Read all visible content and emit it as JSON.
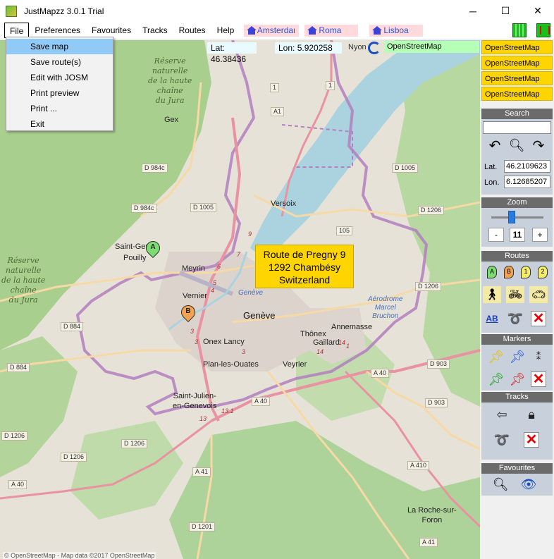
{
  "window": {
    "title": "JustMapzz 3.0.1 Trial",
    "minimize": "─",
    "maximize": "☐",
    "close": "✕"
  },
  "menu": {
    "file": "File",
    "preferences": "Preferences",
    "favourites": "Favourites",
    "tracks": "Tracks",
    "routes": "Routes",
    "help": "Help",
    "quick_favs": [
      "Amsterdam",
      "Roma",
      "Lisboa"
    ]
  },
  "file_menu": {
    "items": [
      "Save map",
      "Save route(s)",
      "Edit with JOSM",
      "Print preview",
      "Print ...",
      "Exit"
    ]
  },
  "map": {
    "lat_label": "Lat:",
    "lat_value": "46.38436",
    "lon_label": "Lon:",
    "lon_value": "5.920258",
    "source": "OpenStreetMap",
    "info_box": [
      "Route de Pregny 9",
      "1292 Chambésy",
      "Switzerland"
    ],
    "attribution": "© OpenStreetMap - Map data ©2017 OpenStreetMap",
    "labels": {
      "reserve_top": [
        "Réserve",
        "naturelle",
        "de la haute",
        "chaîne",
        "du Jura"
      ],
      "reserve_left": [
        "Réserve",
        "naturelle",
        "de la haute",
        "chaîne",
        "du Jura"
      ],
      "gex": "Gex",
      "versoix": "Versoix",
      "saint_genis": "Saint-Genis-",
      "pouilly": "Pouilly",
      "meyrin": "Meyrin",
      "vernier": "Vernier",
      "geneve": "Genève",
      "geneve_lake": "Genève",
      "onex_lancy": "Onex Lancy",
      "plan_les_ouates": "Plan-les-Ouates",
      "thonex": "Thônex",
      "gaillard": "Gaillard",
      "annemasse": "Annemasse",
      "veyrier": "Veyrier",
      "saint_julien": [
        "Saint-Julien-",
        "en-Genevois"
      ],
      "la_roche": [
        "La Roche-sur-",
        "Foron"
      ],
      "aerodrome": [
        "Aérodrome",
        "Marcel",
        "Bruchon"
      ],
      "nyon": "Nyon"
    },
    "roads": [
      "D 984c",
      "D 984c",
      "D 1005",
      "D 1005",
      "D 1206",
      "D 1206",
      "D 884",
      "D 884",
      "D 1206",
      "D 1206",
      "D 1206",
      "D 903",
      "D 903",
      "A 40",
      "A 40",
      "A 41",
      "A 41",
      "D 1201",
      "A 410",
      "A 40",
      "A1",
      "1",
      "1",
      "105"
    ],
    "route_nums": [
      "9",
      "7",
      "6",
      "5",
      "4",
      "3",
      "3",
      "3",
      "13",
      "13.1",
      "14",
      "14",
      "1"
    ],
    "markers": {
      "a": "A",
      "b": "B"
    }
  },
  "panel": {
    "layers": [
      "OpenStreetMap",
      "OpenStreetMap",
      "OpenStreetMap",
      "OpenStreetMap"
    ],
    "search_header": "Search",
    "lat_label": "Lat.",
    "lat_value": "46.2109623",
    "lon_label": "Lon.",
    "lon_value": "6.12685207",
    "zoom_header": "Zoom",
    "zoom_minus": "-",
    "zoom_value": "11",
    "zoom_plus": "+",
    "routes_header": "Routes",
    "route_pins": [
      "A",
      "B",
      "1",
      "2"
    ],
    "ab_label": "AB",
    "markers_header": "Markers",
    "tracks_header": "Tracks",
    "favourites_header": "Favourites"
  },
  "colors": {
    "map_bg": "#e6e2d8",
    "forest": "#a9cf8f",
    "lake": "#aad3df",
    "border": "#b37fc0",
    "motorway": "#e892a2",
    "info_box": "#ffd500",
    "layer_btn": "#ffd500",
    "source_box": "#b6ffb6"
  }
}
